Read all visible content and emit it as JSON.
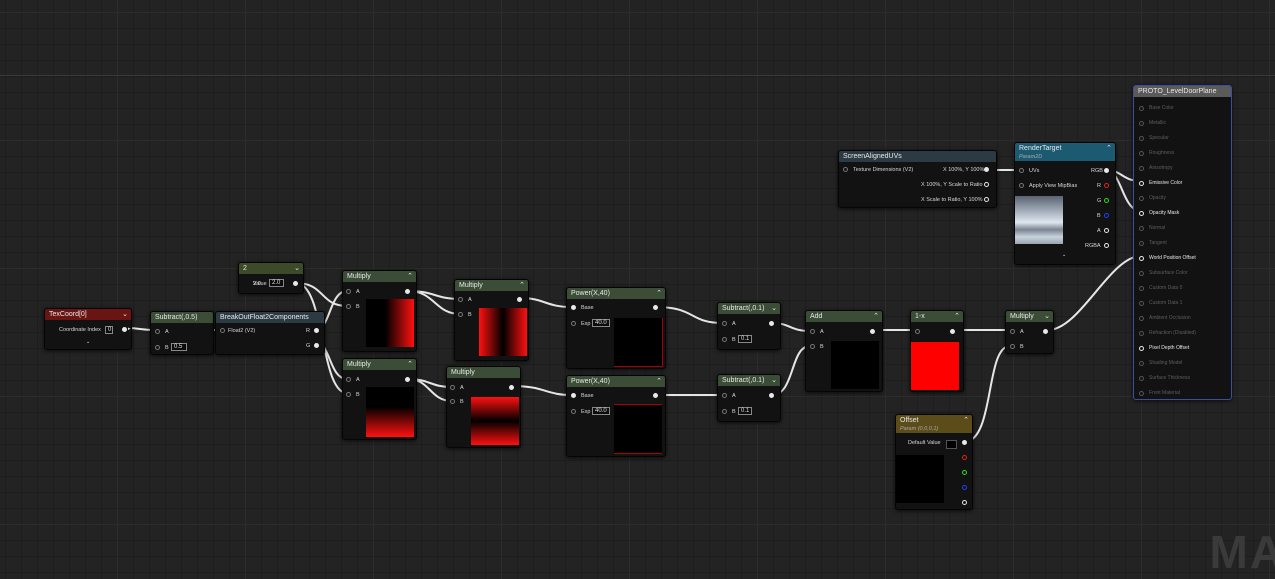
{
  "nodes": {
    "texcoord": {
      "title": "TexCoord[0]",
      "label": "Coordinate Index",
      "value": "0"
    },
    "subtract05": {
      "title": "Subtract(,0.5)",
      "a": "A",
      "b": "B",
      "b_value": "0.5"
    },
    "breakout": {
      "title": "BreakOutFloat2Components",
      "input": "Float2 (V2)",
      "r": "R",
      "g": "G"
    },
    "constant": {
      "title": "2",
      "label": "Value",
      "value": "2.0"
    },
    "multiply1": {
      "title": "Multiply",
      "a": "A",
      "b": "B"
    },
    "multiply2": {
      "title": "Multiply",
      "a": "A",
      "b": "B"
    },
    "multiply3": {
      "title": "Multiply",
      "a": "A",
      "b": "B"
    },
    "multiply4": {
      "title": "Multiply",
      "a": "A",
      "b": "B"
    },
    "power1": {
      "title": "Power(X,40)",
      "base": "Base",
      "exp": "Exp",
      "exp_value": "40.0"
    },
    "power2": {
      "title": "Power(X,40)",
      "base": "Base",
      "exp": "Exp",
      "exp_value": "40.0"
    },
    "subtract01a": {
      "title": "Subtract(,0.1)",
      "a": "A",
      "b": "B",
      "b_value": "0.1"
    },
    "subtract01b": {
      "title": "Subtract(,0.1)",
      "a": "A",
      "b": "B",
      "b_value": "0.1"
    },
    "add": {
      "title": "Add",
      "a": "A",
      "b": "B"
    },
    "oneminus": {
      "title": "1-x"
    },
    "multiply5": {
      "title": "Multiply",
      "a": "A",
      "b": "B"
    },
    "offset": {
      "title": "Offset",
      "subtitle": "Param (0,0,0,1)",
      "label": "Default Value"
    },
    "screenuvs": {
      "title": "ScreenAlignedUVs",
      "input": "Texture Dimensions (V2)",
      "out1": "X 100%, Y 100%",
      "out2": "X 100%, Y Scale to Ratio",
      "out3": "X Scale to Ratio, Y 100%"
    },
    "rendertarget": {
      "title": "RenderTarget",
      "subtitle": "Param2D",
      "uvs": "UVs",
      "mip": "Apply View MipBias",
      "rgb": "RGB",
      "r": "R",
      "g": "G",
      "b": "B",
      "a": "A",
      "rgba": "RGBA"
    },
    "material": {
      "title": "PROTO_LevelDoorPlane",
      "inputs": [
        {
          "label": "Base Color",
          "active": false
        },
        {
          "label": "Metallic",
          "active": false
        },
        {
          "label": "Specular",
          "active": false
        },
        {
          "label": "Roughness",
          "active": false
        },
        {
          "label": "Anisotropy",
          "active": false
        },
        {
          "label": "Emissive Color",
          "active": true
        },
        {
          "label": "Opacity",
          "active": false
        },
        {
          "label": "Opacity Mask",
          "active": true
        },
        {
          "label": "Normal",
          "active": false
        },
        {
          "label": "Tangent",
          "active": false
        },
        {
          "label": "World Position Offset",
          "active": true
        },
        {
          "label": "Subsurface Color",
          "active": false
        },
        {
          "label": "Custom Data 0",
          "active": false
        },
        {
          "label": "Custom Data 1",
          "active": false
        },
        {
          "label": "Ambient Occlusion",
          "active": false
        },
        {
          "label": "Refraction (Disabled)",
          "active": false
        },
        {
          "label": "Pixel Depth Offset",
          "active": true
        },
        {
          "label": "Shading Model",
          "active": false
        },
        {
          "label": "Surface Thickness",
          "active": false
        },
        {
          "label": "Front Material",
          "active": false
        }
      ]
    }
  },
  "colors": {
    "grid_bg": "#232323",
    "node_bg": "#121212",
    "header_green": "#3b4d37",
    "header_red": "#6b1414",
    "header_blue": "#1c5a72",
    "header_yellow": "#5b4c1a",
    "preview_red": "#ff0000",
    "material_border": "#3c4f9c"
  },
  "watermark": "MA"
}
